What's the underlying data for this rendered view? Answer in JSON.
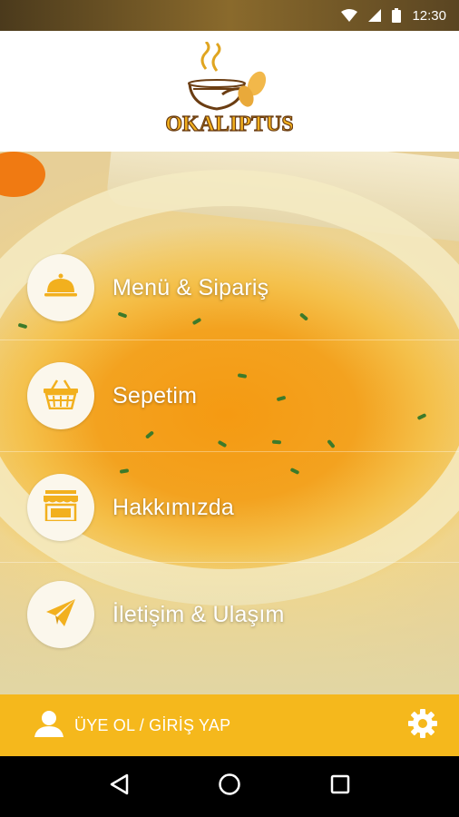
{
  "status_bar": {
    "time": "12:30"
  },
  "header": {
    "logo_text": "OKALIPTUS"
  },
  "menu": {
    "items": [
      {
        "label": "Menü & Sipariş",
        "icon": "food-cloche-icon"
      },
      {
        "label": "Sepetim",
        "icon": "basket-icon"
      },
      {
        "label": "Hakkımızda",
        "icon": "store-icon"
      },
      {
        "label": "İletişim & Ulaşım",
        "icon": "paper-plane-icon"
      }
    ]
  },
  "bottom_bar": {
    "login_label": "ÜYE OL / GİRİŞ YAP"
  },
  "colors": {
    "accent": "#f5b81c",
    "icon": "#f2b01e",
    "brand_brown": "#6b3d12"
  }
}
